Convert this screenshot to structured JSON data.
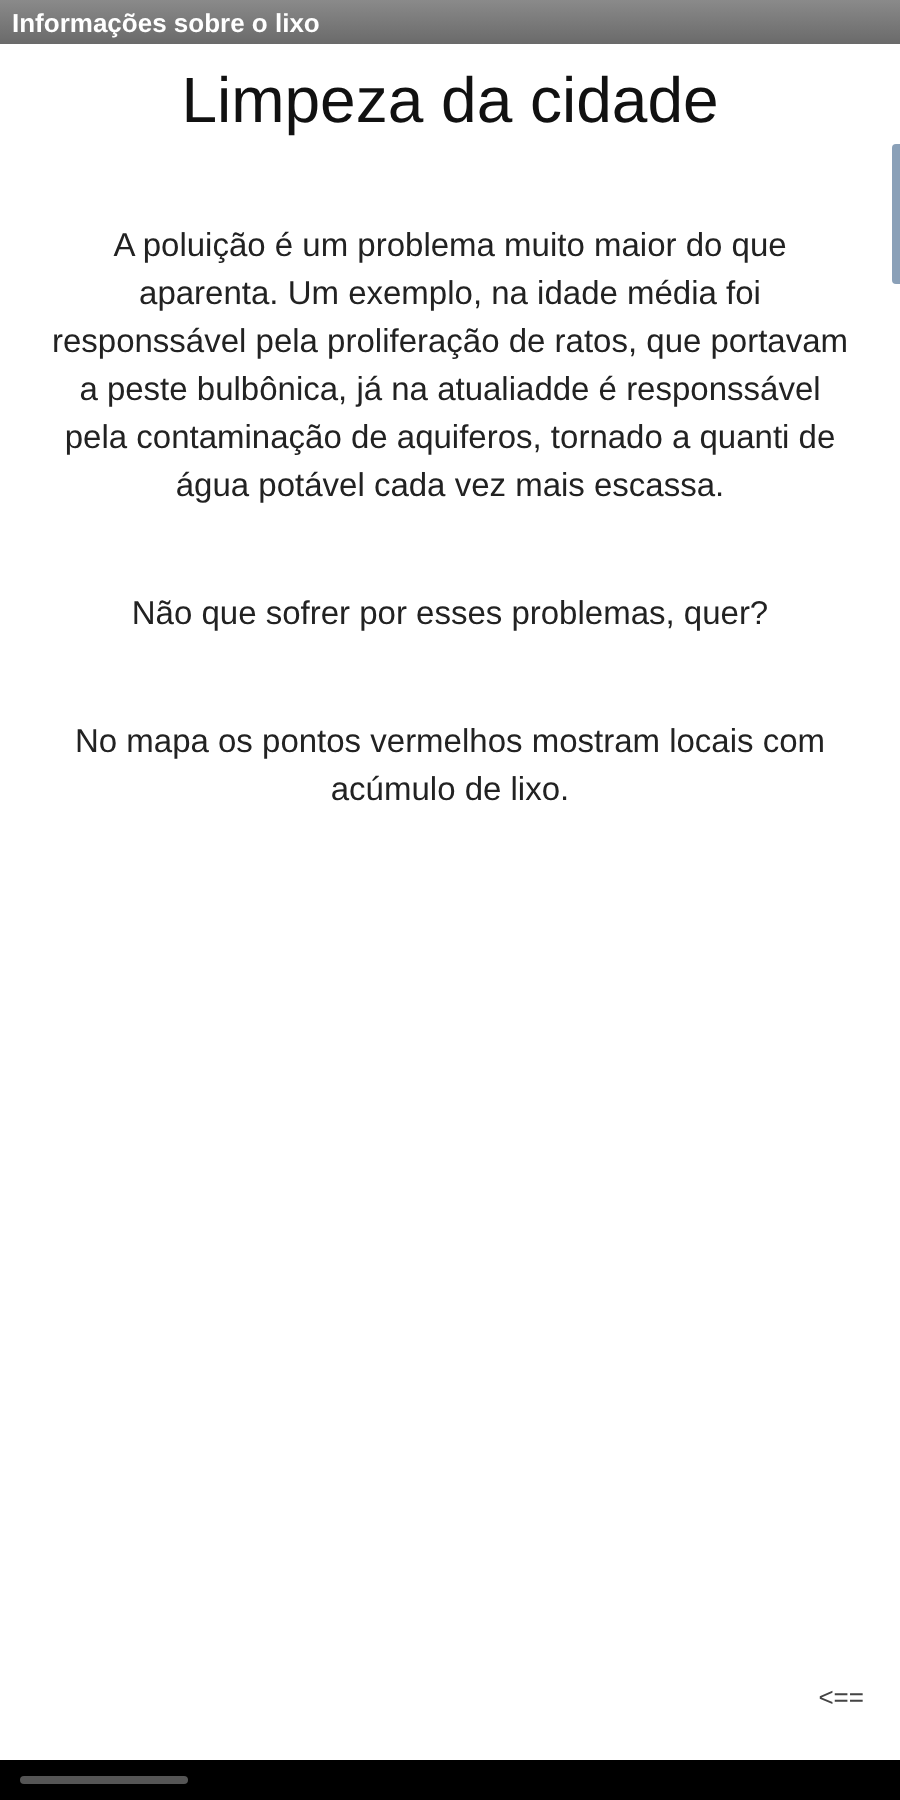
{
  "window": {
    "title": "Informações sobre o lixo"
  },
  "heading": "Limpeza da cidade",
  "paragraphs": [
    "A poluição é um problema muito maior do que aparenta. Um exemplo, na idade média foi responssável pela proliferação de ratos, que portavam a peste bulbônica, já na atualiadde é responssável pela contaminação de aquiferos, tornado a quanti de água potável cada vez mais escassa.",
    "Não que sofrer por esses problemas, quer?",
    "No mapa os pontos vermelhos mostram locais com acúmulo de lixo."
  ],
  "back_button": "<=="
}
